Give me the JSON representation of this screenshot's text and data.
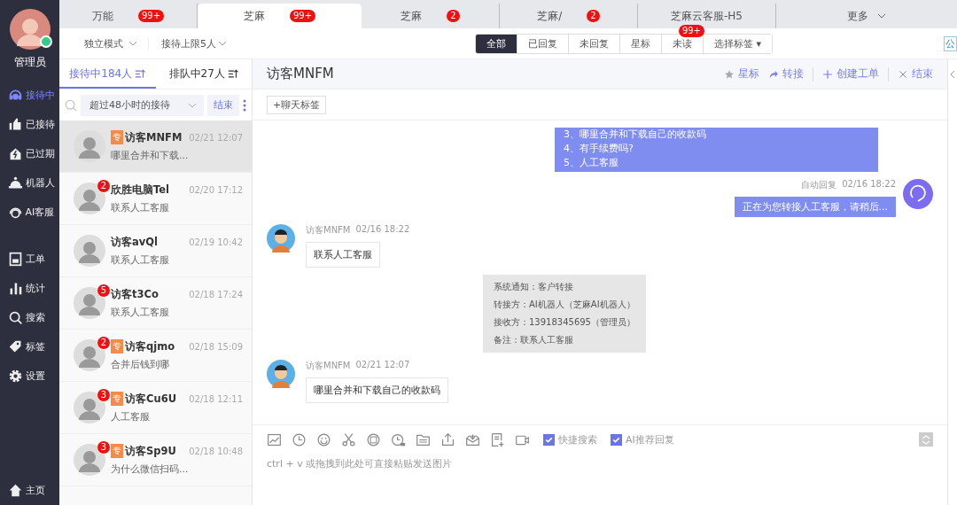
{
  "sidebar": {
    "user": "管理员",
    "online": true,
    "items": [
      {
        "label": "接待中",
        "kind": "headset",
        "selected": true
      },
      {
        "label": "已接待",
        "kind": "thumb",
        "selected": false
      },
      {
        "label": "已过期",
        "kind": "bolt",
        "selected": false
      },
      {
        "label": "机器人",
        "kind": "robot",
        "selected": false
      },
      {
        "label": "AI客服",
        "kind": "ai",
        "selected": false
      },
      {
        "label": "工单",
        "kind": "form",
        "selected": false
      },
      {
        "label": "统计",
        "kind": "bars",
        "selected": false
      },
      {
        "label": "搜索",
        "kind": "search",
        "selected": false
      },
      {
        "label": "标签",
        "kind": "tag",
        "selected": false
      },
      {
        "label": "设置",
        "kind": "gear",
        "selected": false
      }
    ],
    "home": "主页"
  },
  "tabs": [
    {
      "label": "万能",
      "badge": "99+",
      "selected": false
    },
    {
      "label": "芝麻",
      "badge": "99+",
      "selected": true
    },
    {
      "label": "芝麻",
      "badge": "2",
      "selected": false
    },
    {
      "label": "芝麻/",
      "badge": "2",
      "selected": false
    },
    {
      "label": "芝麻云客服-H5",
      "selected": false
    }
  ],
  "more": "更多",
  "toolbar": {
    "mode": "独立模式",
    "limit": "接待上限5人",
    "notice": "公",
    "filters": [
      {
        "label": "全部",
        "selected": true
      },
      {
        "label": "已回复",
        "selected": false
      },
      {
        "label": "未回复",
        "selected": false
      },
      {
        "label": "星标",
        "selected": false
      },
      {
        "label": "未读",
        "badge": "99+",
        "selected": false
      },
      {
        "label": "选择标签 ▾",
        "selected": false
      }
    ]
  },
  "list": {
    "tabs": [
      {
        "label": "接待中184人",
        "selected": true
      },
      {
        "label": "排队中27人",
        "selected": false
      }
    ],
    "filter": "超过48小时的接待",
    "end": "结束",
    "items": [
      {
        "name": "访客MNFM",
        "tag": "专",
        "time": "02/21 12:07",
        "preview": "哪里合并和下载...",
        "selected": true
      },
      {
        "name": "欣胜电脑Tel",
        "badge": "2",
        "time": "02/20 17:12",
        "preview": "联系人工客服",
        "selected": false
      },
      {
        "name": "访客avQl",
        "time": "02/19 10:42",
        "preview": "联系人工客服",
        "selected": false
      },
      {
        "name": "访客t3Co",
        "badge": "5",
        "time": "02/18 17:24",
        "preview": "联系人工客服",
        "selected": false
      },
      {
        "name": "访客qjmo",
        "badge": "2",
        "tag": "专",
        "time": "02/18 15:09",
        "preview": "合并后钱到哪",
        "selected": false
      },
      {
        "name": "访客Cu6U",
        "badge": "3",
        "tag": "专",
        "time": "02/18 12:11",
        "preview": "人工客服",
        "selected": false
      },
      {
        "name": "访客Sp9U",
        "badge": "3",
        "tag": "专",
        "time": "02/18 10:48",
        "preview": "为什么微信扫码...",
        "selected": false
      }
    ]
  },
  "chat": {
    "title": "访客MNFM",
    "actions": [
      {
        "label": "星标",
        "kind": "star"
      },
      {
        "label": "转接",
        "kind": "forward"
      },
      {
        "label": "创建工单",
        "kind": "plus"
      },
      {
        "label": "结束",
        "kind": "close"
      }
    ],
    "chat_tag": "+聊天标签",
    "messages": [
      {
        "kind": "bot",
        "lines": [
          "3、哪里合并和下载自己的收款码",
          "4、有手续费吗?",
          "5、人工客服"
        ]
      },
      {
        "kind": "agent",
        "sender": "自动回复",
        "time": "02/16 18:22",
        "text": "正在为您转接人工客服，请稍后..."
      },
      {
        "kind": "visitor",
        "sender": "访客MNFM",
        "time": "02/16 18:22",
        "text": "联系人工客服"
      },
      {
        "kind": "system",
        "lines": [
          "系统通知：客户转接",
          "转接方：AI机器人（芝麻AI机器人）",
          "接收方：13918345695（管理员）",
          "备注：联系人工客服"
        ]
      },
      {
        "kind": "visitor",
        "sender": "访客MNFM",
        "time": "02/21 12:07",
        "text": "哪里合并和下载自己的收款码"
      }
    ],
    "options": [
      {
        "label": "快捷搜索",
        "checked": true
      },
      {
        "label": "AI推荐回复",
        "checked": true
      }
    ],
    "placeholder": "ctrl + v 或拖拽到此处可直接粘贴发送图片"
  }
}
